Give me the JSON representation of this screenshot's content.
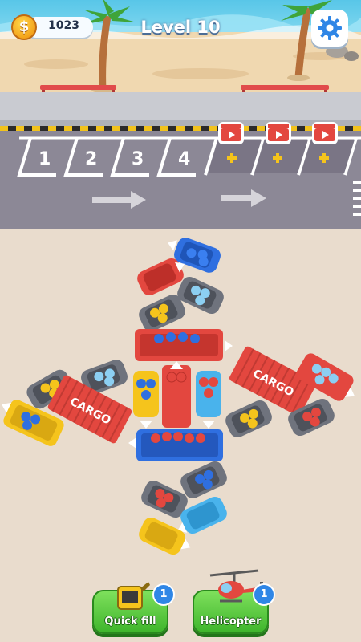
{
  "hud": {
    "coins": "1023",
    "coin_symbol": "$",
    "level_label": "Level 10"
  },
  "parking": {
    "slots": [
      "1",
      "2",
      "3",
      "4"
    ],
    "locked_slots": 3
  },
  "vehicles": {
    "container_text": "CARGO"
  },
  "boosters": {
    "quick_fill": {
      "label": "Quick fill",
      "count": "1"
    },
    "helicopter": {
      "label": "Helicopter",
      "count": "1"
    }
  },
  "colors": {
    "sand": "#f0d8b0",
    "road": "#8c8896",
    "lot": "#e9dccd",
    "red": "#e3473f",
    "blue": "#2f6fe0",
    "yellow": "#f5c41c",
    "gray": "#6f737d",
    "button_green": "#4cc236"
  }
}
